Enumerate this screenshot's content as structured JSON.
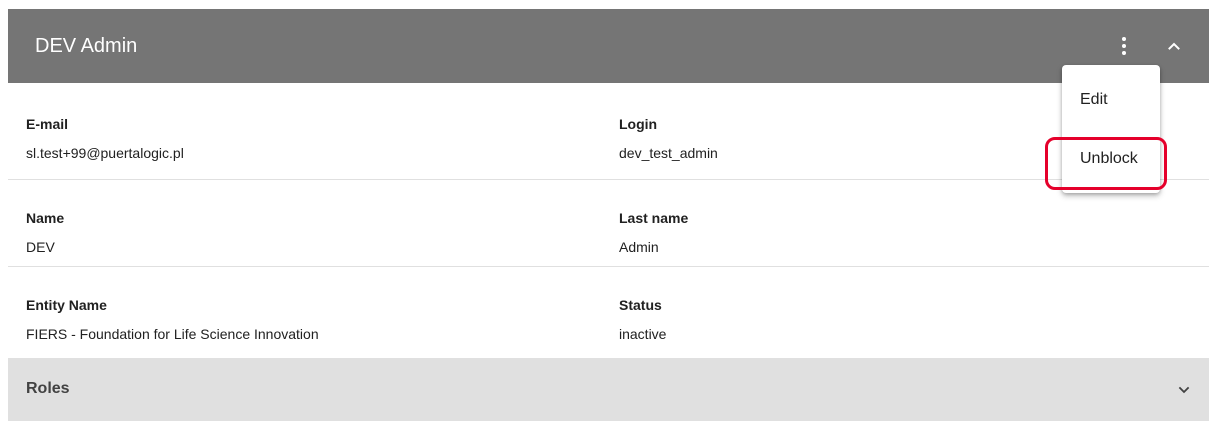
{
  "header": {
    "title": "DEV Admin",
    "more_icon": "more-vertical-icon",
    "collapse_icon": "chevron-up-icon"
  },
  "fields": {
    "email": {
      "label": "E-mail",
      "value": "sl.test+99@puertalogic.pl"
    },
    "login": {
      "label": "Login",
      "value": "dev_test_admin"
    },
    "name": {
      "label": "Name",
      "value": "DEV"
    },
    "last_name": {
      "label": "Last name",
      "value": "Admin"
    },
    "entity_name": {
      "label": "Entity Name",
      "value": "FIERS - Foundation for Life Science Innovation"
    },
    "status": {
      "label": "Status",
      "value": "inactive"
    }
  },
  "roles": {
    "title": "Roles",
    "expand_icon": "chevron-down-icon"
  },
  "menu": {
    "items": [
      {
        "label": "Edit"
      },
      {
        "label": "Unblock"
      }
    ]
  },
  "colors": {
    "header_bg": "#757575",
    "roles_bg": "#e0e0e0",
    "highlight": "#e5002b"
  }
}
